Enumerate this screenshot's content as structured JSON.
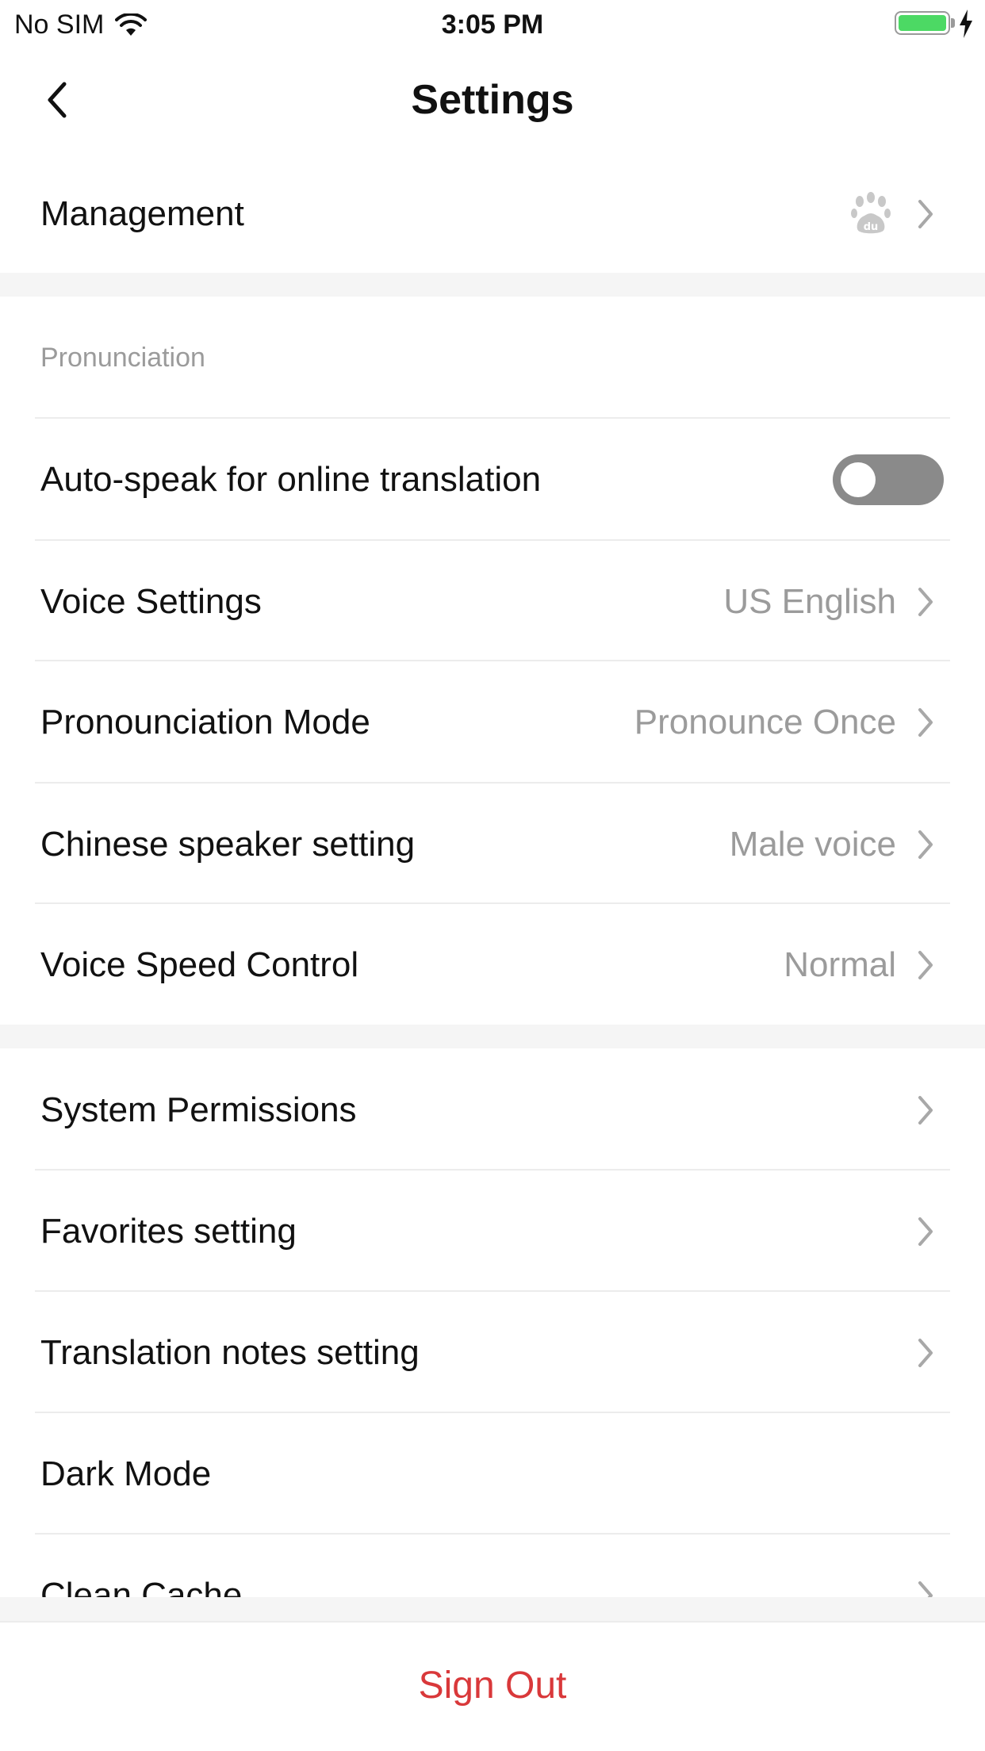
{
  "status_bar": {
    "carrier": "No SIM",
    "time": "3:05 PM"
  },
  "nav": {
    "title": "Settings"
  },
  "management": {
    "label": "Management",
    "icon": "baidu-paw-icon"
  },
  "pronunciation": {
    "header": "Pronunciation",
    "auto_speak": {
      "label": "Auto-speak for online translation",
      "enabled": false
    },
    "voice_settings": {
      "label": "Voice Settings",
      "value": "US English"
    },
    "pronunciation_mode": {
      "label": "Pronounciation Mode",
      "value": "Pronounce Once"
    },
    "chinese_speaker": {
      "label": "Chinese speaker setting",
      "value": "Male voice"
    },
    "voice_speed": {
      "label": "Voice Speed Control",
      "value": "Normal"
    }
  },
  "general": {
    "system_permissions": {
      "label": "System Permissions"
    },
    "favorites": {
      "label": "Favorites setting"
    },
    "translation_notes": {
      "label": "Translation notes setting"
    },
    "dark_mode": {
      "label": "Dark Mode"
    },
    "clean_cache": {
      "label": "Clean Cache"
    }
  },
  "footer": {
    "sign_out": "Sign Out"
  },
  "colors": {
    "accent_red": "#d9383a",
    "toggle_off": "#8a8a8a",
    "battery_green": "#4cd964",
    "muted_text": "#9b9b9b"
  }
}
